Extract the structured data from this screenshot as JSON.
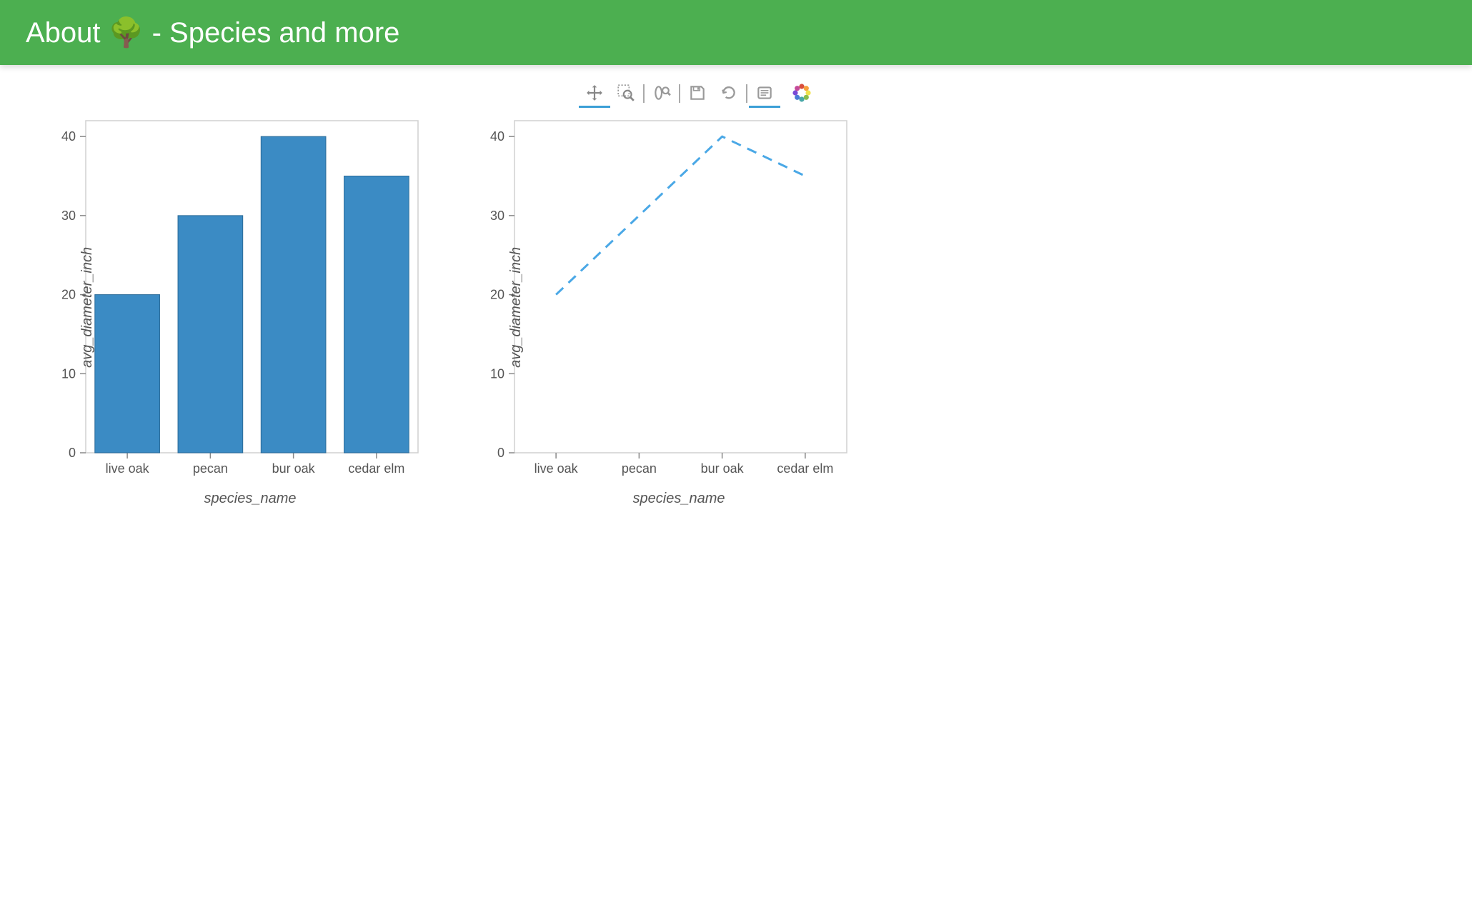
{
  "header": {
    "title_prefix": "About ",
    "title_emoji": "🌳",
    "title_suffix": " - Species and more"
  },
  "toolbar": {
    "items": [
      {
        "name": "pan",
        "active": true
      },
      {
        "name": "box-zoom",
        "active": false
      },
      {
        "name": "wheel-zoom",
        "active": false
      },
      {
        "name": "save",
        "active": false
      },
      {
        "name": "reset",
        "active": false
      },
      {
        "name": "hover",
        "active": true
      }
    ],
    "logo": "bokeh"
  },
  "chart_data": [
    {
      "type": "bar",
      "categories": [
        "live oak",
        "pecan",
        "bur oak",
        "cedar elm"
      ],
      "values": [
        20,
        30,
        40,
        35
      ],
      "xlabel": "species_name",
      "ylabel": "avg_diameter_inch",
      "ylim": [
        0,
        42
      ],
      "yticks": [
        0,
        10,
        20,
        30,
        40
      ]
    },
    {
      "type": "line",
      "categories": [
        "live oak",
        "pecan",
        "bur oak",
        "cedar elm"
      ],
      "values": [
        20,
        30,
        40,
        35
      ],
      "xlabel": "species_name",
      "ylabel": "avg_diameter_inch",
      "ylim": [
        0,
        42
      ],
      "yticks": [
        0,
        10,
        20,
        30,
        40
      ],
      "style": "dashed"
    }
  ],
  "colors": {
    "header_bg": "#4CAF50",
    "bar_fill": "#3b8bc4",
    "line_stroke": "#4aa8e6"
  }
}
